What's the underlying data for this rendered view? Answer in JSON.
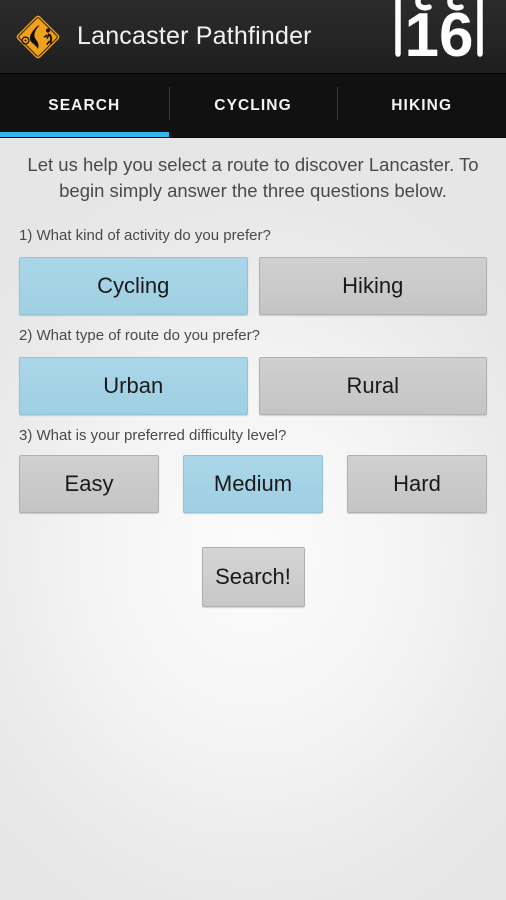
{
  "app": {
    "title": "Lancaster Pathfinder",
    "icon_name": "pathfinder-diamond-sign-icon",
    "badge_number": "16",
    "accent_color": "#33b5e5",
    "selected_color": "#a4d2e5",
    "unselected_color": "#c9c9c9"
  },
  "tabs": [
    {
      "label": "SEARCH",
      "active": true
    },
    {
      "label": "CYCLING",
      "active": false
    },
    {
      "label": "HIKING",
      "active": false
    }
  ],
  "main": {
    "intro": "Let us help you select a route to discover Lancaster. To begin simply answer the three questions below.",
    "questions": [
      {
        "label": "1) What kind of activity do you prefer?",
        "options": [
          {
            "label": "Cycling",
            "selected": true
          },
          {
            "label": "Hiking",
            "selected": false
          }
        ]
      },
      {
        "label": "2) What type of route do you prefer?",
        "options": [
          {
            "label": "Urban",
            "selected": true
          },
          {
            "label": "Rural",
            "selected": false
          }
        ]
      },
      {
        "label": "3) What is your preferred difficulty level?",
        "options": [
          {
            "label": "Easy",
            "selected": false
          },
          {
            "label": "Medium",
            "selected": true
          },
          {
            "label": "Hard",
            "selected": false
          }
        ]
      }
    ],
    "search_button": "Search!"
  }
}
